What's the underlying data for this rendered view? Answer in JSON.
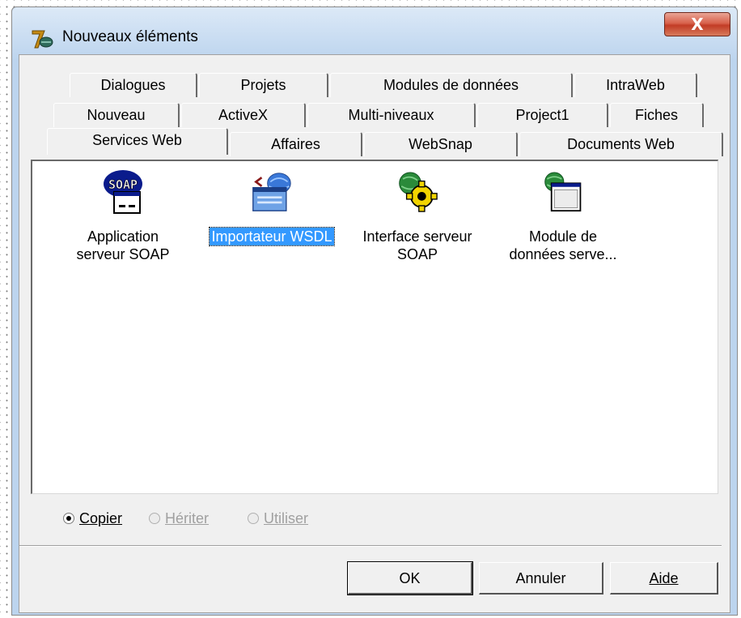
{
  "window": {
    "title": "Nouveaux éléments",
    "close_label": "X"
  },
  "tabs": {
    "row1": [
      "Dialogues",
      "Projets",
      "Modules de données",
      "IntraWeb"
    ],
    "row2": [
      "Nouveau",
      "ActiveX",
      "Multi-niveaux",
      "Project1",
      "Fiches"
    ],
    "row3": [
      "Services Web",
      "Affaires",
      "WebSnap",
      "Documents Web"
    ],
    "active": "Services Web"
  },
  "items": [
    {
      "label_line1": "Application",
      "label_line2": "serveur SOAP",
      "icon": "soap-server-app-icon",
      "selected": false
    },
    {
      "label_line1": "Importateur WSDL",
      "label_line2": "",
      "icon": "wsdl-importer-icon",
      "selected": true
    },
    {
      "label_line1": "Interface serveur",
      "label_line2": "SOAP",
      "icon": "soap-server-interface-icon",
      "selected": false
    },
    {
      "label_line1": "Module de",
      "label_line2": "données serve...",
      "icon": "soap-data-module-icon",
      "selected": false
    }
  ],
  "icon_badge_text": "SOAP",
  "options": [
    {
      "label": "Copier",
      "checked": true,
      "enabled": true
    },
    {
      "label": "Hériter",
      "checked": false,
      "enabled": false
    },
    {
      "label": "Utiliser",
      "checked": false,
      "enabled": false
    }
  ],
  "buttons": {
    "ok": "OK",
    "cancel": "Annuler",
    "help": "Aide"
  },
  "colors": {
    "selection": "#3399ff",
    "close_button": "#c23c25",
    "frame": "#bcd4ee"
  }
}
